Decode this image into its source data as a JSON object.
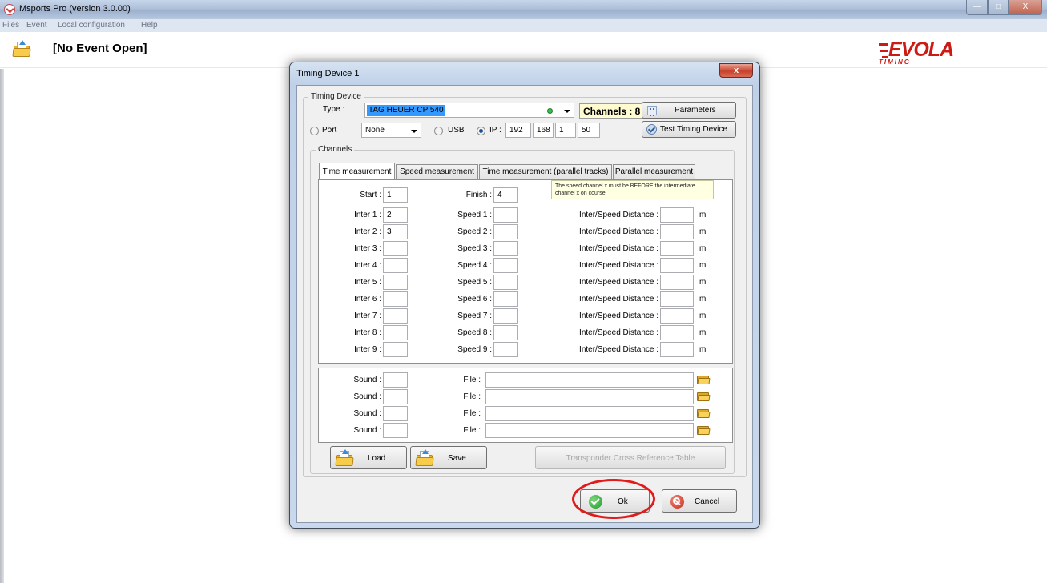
{
  "window": {
    "title": "Msports Pro (version 3.0.00)"
  },
  "menu": {
    "items": [
      "Files",
      "Event",
      "Local configuration",
      "Help"
    ]
  },
  "toolbar": {
    "event_status": "[No Event Open]"
  },
  "logo": {
    "brand": "EVOLA",
    "sub": "TIMING"
  },
  "dialog": {
    "title": "Timing Device 1",
    "close_label": "x",
    "timing_device": {
      "legend": "Timing Device",
      "type_label": "Type :",
      "type_value": "TAG HEUER CP 540",
      "channels_label": "Channels : 8",
      "parameters_label": "Parameters",
      "port_label": "Port :",
      "port_value": "None",
      "usb_label": "USB",
      "ip_label": "IP :",
      "ip_octets": [
        "192",
        "168",
        "1",
        "50"
      ],
      "test_label": "Test Timing Device",
      "connection_mode": "IP"
    },
    "channels": {
      "legend": "Channels",
      "tabs": [
        "Time measurement",
        "Speed measurement",
        "Time measurement (parallel tracks)",
        "Parallel measurement"
      ],
      "active_tab": "Time measurement",
      "start_label": "Start :",
      "start_value": "1",
      "finish_label": "Finish :",
      "finish_value": "4",
      "note": "The speed channel x must be BEFORE the intermediate channel x on course.",
      "distance_unit": "m",
      "rows": [
        {
          "inter_label": "Inter 1 :",
          "inter_value": "2",
          "speed_label": "Speed 1 :",
          "speed_value": "",
          "distance_label": "Inter/Speed Distance :",
          "distance_value": ""
        },
        {
          "inter_label": "Inter 2 :",
          "inter_value": "3",
          "speed_label": "Speed 2 :",
          "speed_value": "",
          "distance_label": "Inter/Speed Distance :",
          "distance_value": ""
        },
        {
          "inter_label": "Inter 3 :",
          "inter_value": "",
          "speed_label": "Speed 3 :",
          "speed_value": "",
          "distance_label": "Inter/Speed Distance :",
          "distance_value": ""
        },
        {
          "inter_label": "Inter 4 :",
          "inter_value": "",
          "speed_label": "Speed 4 :",
          "speed_value": "",
          "distance_label": "Inter/Speed Distance :",
          "distance_value": ""
        },
        {
          "inter_label": "Inter 5 :",
          "inter_value": "",
          "speed_label": "Speed 5 :",
          "speed_value": "",
          "distance_label": "Inter/Speed Distance :",
          "distance_value": ""
        },
        {
          "inter_label": "Inter 6 :",
          "inter_value": "",
          "speed_label": "Speed 6 :",
          "speed_value": "",
          "distance_label": "Inter/Speed Distance :",
          "distance_value": ""
        },
        {
          "inter_label": "Inter 7 :",
          "inter_value": "",
          "speed_label": "Speed 7 :",
          "speed_value": "",
          "distance_label": "Inter/Speed Distance :",
          "distance_value": ""
        },
        {
          "inter_label": "Inter 8 :",
          "inter_value": "",
          "speed_label": "Speed 8 :",
          "speed_value": "",
          "distance_label": "Inter/Speed Distance :",
          "distance_value": ""
        },
        {
          "inter_label": "Inter 9 :",
          "inter_value": "",
          "speed_label": "Speed 9 :",
          "speed_value": "",
          "distance_label": "Inter/Speed Distance :",
          "distance_value": ""
        }
      ],
      "sounds": [
        {
          "sound_label": "Sound :",
          "sound_value": "",
          "file_label": "File :",
          "file_value": ""
        },
        {
          "sound_label": "Sound :",
          "sound_value": "",
          "file_label": "File :",
          "file_value": ""
        },
        {
          "sound_label": "Sound :",
          "sound_value": "",
          "file_label": "File :",
          "file_value": ""
        },
        {
          "sound_label": "Sound :",
          "sound_value": "",
          "file_label": "File :",
          "file_value": ""
        }
      ],
      "load_label": "Load",
      "save_label": "Save",
      "transponder_label": "Transponder Cross Reference Table"
    },
    "ok_label": "Ok",
    "cancel_label": "Cancel"
  },
  "colors": {
    "accent_logo": "#cc1b16",
    "annotation_circle": "#e11a1a",
    "selection": "#3399ff"
  }
}
